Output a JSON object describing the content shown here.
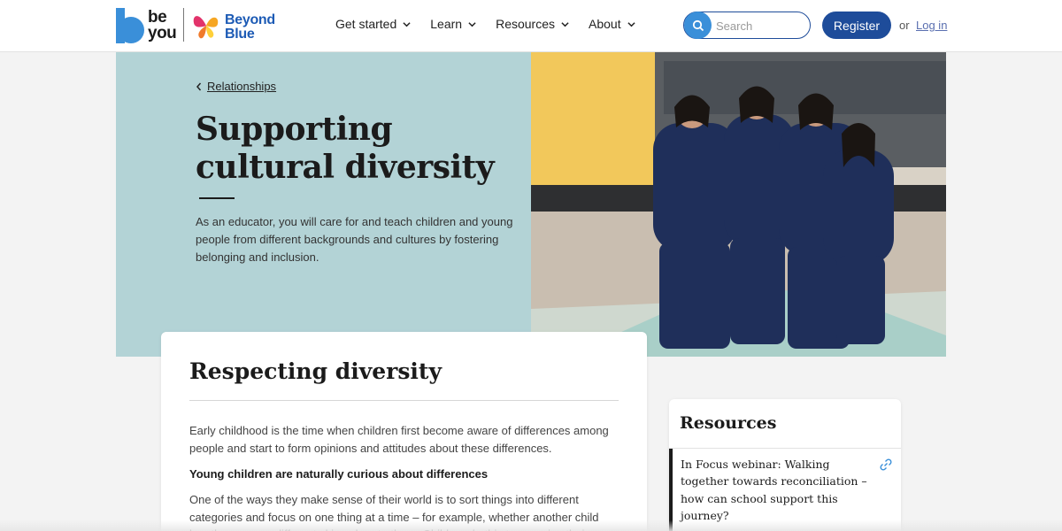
{
  "header": {
    "logo_beyou_line1": "be",
    "logo_beyou_line2": "you",
    "logo_bb_line1": "Beyond",
    "logo_bb_line2": "Blue",
    "nav": [
      {
        "label": "Get started"
      },
      {
        "label": "Learn"
      },
      {
        "label": "Resources"
      },
      {
        "label": "About"
      }
    ],
    "search_placeholder": "Search",
    "register_label": "Register",
    "or_text": "or",
    "login_label": "Log in"
  },
  "hero": {
    "breadcrumb": "Relationships",
    "title": "Supporting cultural diversity",
    "description": "As an educator, you will care for and teach children and young people from different backgrounds and cultures by fostering belonging and inclusion."
  },
  "content": {
    "heading": "Respecting diversity",
    "paragraph1": "Early childhood is the time when children first become aware of differences among people and start to form opinions and attitudes about these differences.",
    "subheading": "Young children are naturally curious about differences",
    "paragraph2": "One of the ways they make sense of their world is to sort things into different categories and focus on one thing at a time – for example, whether another child has the same or different skin colour to them. Children do this to organise their"
  },
  "resources": {
    "title": "Resources",
    "items": [
      {
        "text": "In Focus webinar: Walking together towards reconciliation – how can school support this journey?"
      }
    ]
  },
  "colors": {
    "brand_blue": "#1e4c9a",
    "hero_teal": "#b3d3d6",
    "search_button": "#3a8fd9"
  }
}
